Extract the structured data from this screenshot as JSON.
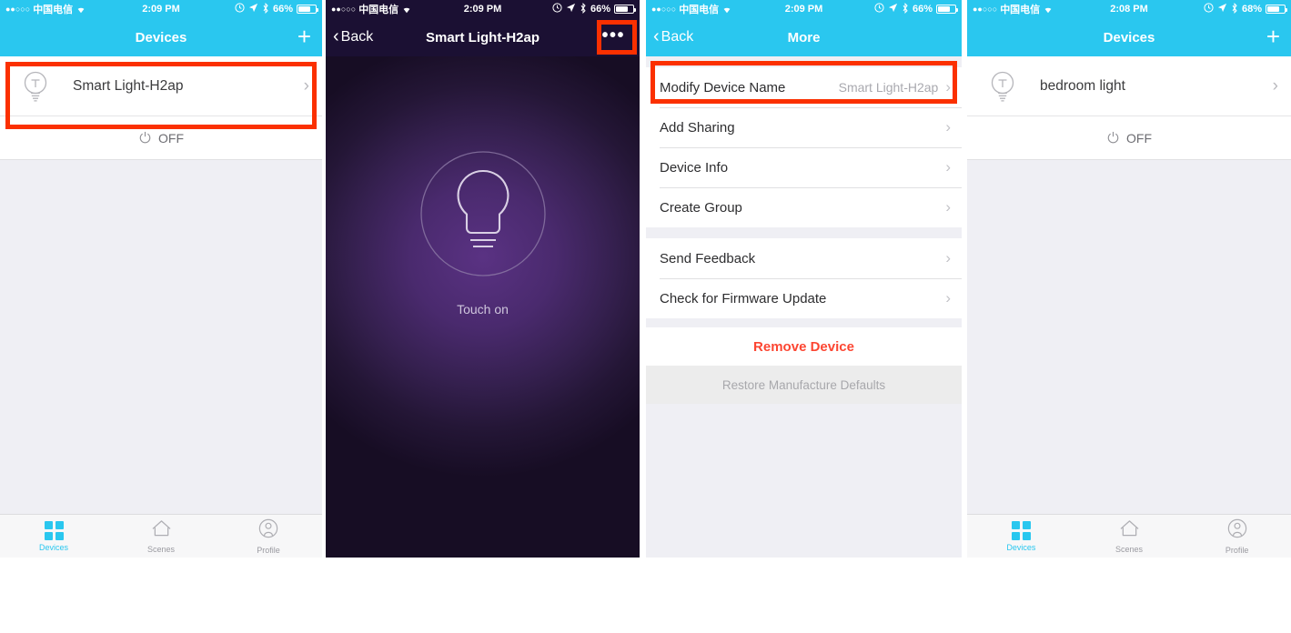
{
  "statusbar": {
    "signal_dots": "●●○○○",
    "carrier": "中国电信",
    "wifi_icon": "wifi-icon",
    "time_209": "2:09 PM",
    "time_208": "2:08 PM",
    "alarm_icon": "alarm-icon",
    "location_icon": "location-arrow-icon",
    "bluetooth_icon": "bluetooth-icon",
    "battery_66": "66%",
    "battery_68": "68%"
  },
  "panel1": {
    "nav": {
      "title": "Devices",
      "add_label": "+"
    },
    "device": {
      "icon": "light-bulb-icon",
      "name": "Smart Light-H2ap",
      "chevron": "›",
      "power_state": "OFF",
      "power_icon": "power-icon"
    },
    "highlight": "device-row-highlight"
  },
  "panel2": {
    "nav": {
      "back_label": "Back",
      "back_icon": "chevron-left-icon",
      "title": "Smart Light-H2ap",
      "more_icon": "ellipsis-icon"
    },
    "bulb_icon": "light-bulb-outline-icon",
    "touch_label": "Touch on",
    "highlight": "more-button-highlight"
  },
  "panel3": {
    "nav": {
      "back_label": "Back",
      "back_icon": "chevron-left-icon",
      "title": "More"
    },
    "group1": [
      {
        "label": "Modify Device Name",
        "value": "Smart Light-H2ap",
        "chevron": "›"
      },
      {
        "label": "Add Sharing",
        "value": "",
        "chevron": "›"
      },
      {
        "label": "Device Info",
        "value": "",
        "chevron": "›"
      },
      {
        "label": "Create Group",
        "value": "",
        "chevron": "›"
      }
    ],
    "group2": [
      {
        "label": "Send Feedback",
        "value": "",
        "chevron": "›"
      },
      {
        "label": "Check for Firmware Update",
        "value": "",
        "chevron": "›"
      }
    ],
    "remove_label": "Remove Device",
    "restore_label": "Restore Manufacture Defaults",
    "highlight": "modify-device-name-highlight"
  },
  "panel4": {
    "nav": {
      "title": "Devices",
      "add_label": "+"
    },
    "device": {
      "icon": "light-bulb-icon",
      "name": "bedroom light",
      "chevron": "›",
      "power_state": "OFF",
      "power_icon": "power-icon"
    }
  },
  "tabbar": {
    "items": [
      {
        "label": "Devices",
        "icon": "grid-icon",
        "active": true
      },
      {
        "label": "Scenes",
        "icon": "home-icon",
        "active": false
      },
      {
        "label": "Profile",
        "icon": "person-icon",
        "active": false
      }
    ]
  },
  "colors": {
    "accent_blue": "#2ac7ef",
    "highlight_red": "#fb3000",
    "danger_red": "#fc4632",
    "dark_nav": "#1b1033",
    "list_bg": "#efeff4"
  }
}
